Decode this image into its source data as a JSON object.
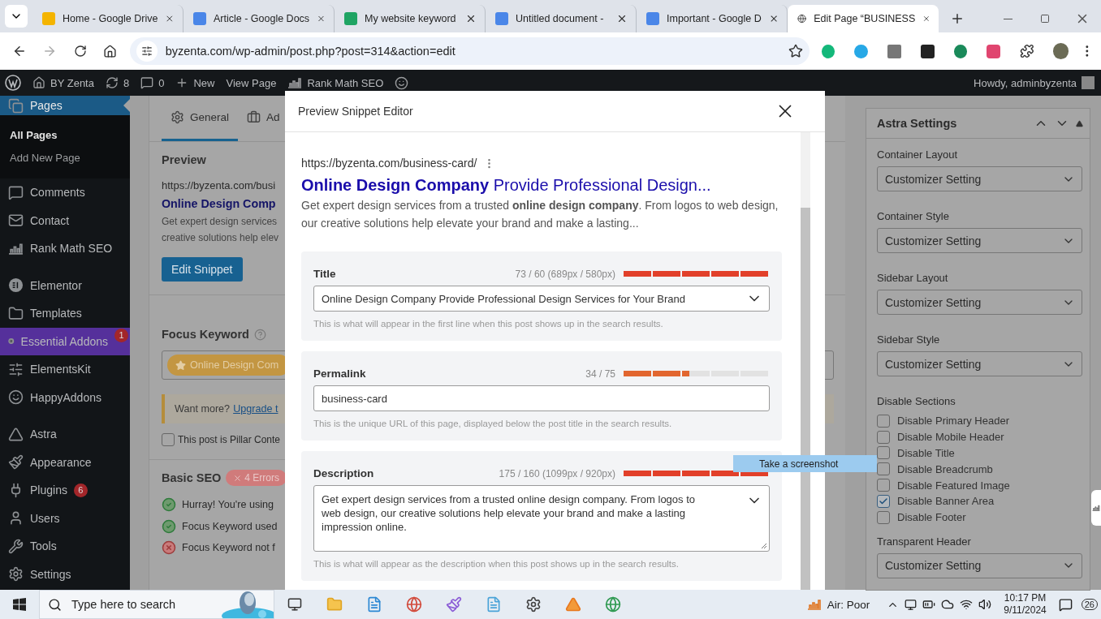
{
  "browser": {
    "tabs": [
      {
        "title": "Home - Google Drive",
        "selected": false
      },
      {
        "title": "Article - Google Docs",
        "selected": false
      },
      {
        "title": "My website keyword",
        "selected": false
      },
      {
        "title": "Untitled document -",
        "selected": false
      },
      {
        "title": "Important - Google D",
        "selected": false
      },
      {
        "title": "Edit Page “BUSINESS",
        "selected": true
      }
    ],
    "url": "byzenta.com/wp-admin/post.php?post=314&action=edit"
  },
  "admin_bar": {
    "items": [
      "BY Zenta",
      "8",
      "0",
      "New",
      "View Page",
      "Rank Math SEO"
    ],
    "greeting": "Howdy, adminbyzenta"
  },
  "sidebar": {
    "groups": [
      {
        "items": [
          {
            "label": "Pages",
            "selected": true,
            "highlighted": false,
            "children": [
              {
                "label": "All Pages",
                "selected": true
              },
              {
                "label": "Add New Page",
                "selected": false
              }
            ]
          },
          {
            "label": "Comments",
            "selected": false,
            "highlighted": false
          },
          {
            "label": "Contact",
            "selected": false,
            "highlighted": false
          },
          {
            "label": "Rank Math SEO",
            "selected": false,
            "highlighted": false
          }
        ]
      },
      {
        "items": [
          {
            "label": "Elementor",
            "selected": false,
            "highlighted": false
          },
          {
            "label": "Templates",
            "selected": false,
            "highlighted": false
          },
          {
            "label": "Essential Addons",
            "selected": false,
            "highlighted": true,
            "badge": "1"
          },
          {
            "label": "ElementsKit",
            "selected": false,
            "highlighted": false
          },
          {
            "label": "HappyAddons",
            "selected": false,
            "highlighted": false
          }
        ]
      },
      {
        "items": [
          {
            "label": "Astra",
            "selected": false,
            "highlighted": false
          },
          {
            "label": "Appearance",
            "selected": false,
            "highlighted": false
          },
          {
            "label": "Plugins",
            "selected": false,
            "highlighted": false,
            "badge": "6"
          },
          {
            "label": "Users",
            "selected": false,
            "highlighted": false
          },
          {
            "label": "Tools",
            "selected": false,
            "highlighted": false
          },
          {
            "label": "Settings",
            "selected": false,
            "highlighted": false
          }
        ]
      }
    ]
  },
  "rank_math": {
    "tabs": [
      {
        "label": "General",
        "selected": true
      },
      {
        "label": "Ad",
        "selected": false
      }
    ],
    "preview": {
      "heading": "Preview",
      "url": "https://byzenta.com/busi",
      "title": "Online Design Comp",
      "description_lines": [
        "Get expert design services",
        "creative solutions help elev"
      ],
      "button": "Edit Snippet"
    },
    "focus_keyword": {
      "label": "Focus Keyword",
      "keyword": "Online Design Com"
    },
    "notice": {
      "text": "Want more?",
      "link": "Upgrade t"
    },
    "pillar": {
      "label": "This post is Pillar Conte",
      "checked": false
    },
    "basic_seo": {
      "heading": "Basic SEO",
      "badge": "4 Errors",
      "checks": [
        {
          "text": "Hurray! You're using",
          "passed": true
        },
        {
          "text": "Focus Keyword used",
          "passed": true
        },
        {
          "text": "Focus Keyword not f",
          "passed": false
        }
      ]
    }
  },
  "modal": {
    "title": "Preview Snippet Editor",
    "snippet": {
      "url": "https://byzenta.com/business-card/",
      "title": "**Online Design Company** Provide Professional Design...",
      "description": "Get expert design services from a trusted **online design company**. From logos to web design, our creative solutions help elevate your brand and make a lasting..."
    },
    "fields": [
      {
        "kind": "select",
        "label": "Title",
        "counter": "73 / 60 (689px / 580px)",
        "level": 1,
        "color": "#e2402a",
        "value": "Online Design Company Provide Professional Design Services for Your Brand",
        "help": "This is what will appear in the first line when this post shows up in the search results."
      },
      {
        "kind": "input",
        "label": "Permalink",
        "counter": "34 / 75",
        "level": 0.45,
        "color": "#e2662f",
        "value": "business-card",
        "help": "This is the unique URL of this page, displayed below the post title in the search results."
      },
      {
        "kind": "textarea",
        "label": "Description",
        "counter": "175 / 160 (1099px / 920px)",
        "level": 1,
        "color": "#e2402a",
        "value": "Get expert design services from a trusted online design company. From logos to web design, our creative solutions help elevate your brand and make a lasting impression online.",
        "help": "This is what will appear as the description when this post shows up in the search results."
      }
    ]
  },
  "tooltip": "Take a screenshot",
  "astra": {
    "title": "Astra Settings",
    "sections": [
      {
        "kind": "select",
        "label": "Container Layout",
        "value": "Customizer Setting"
      },
      {
        "kind": "select",
        "label": "Container Style",
        "value": "Customizer Setting"
      },
      {
        "kind": "select",
        "label": "Sidebar Layout",
        "value": "Customizer Setting"
      },
      {
        "kind": "select",
        "label": "Sidebar Style",
        "value": "Customizer Setting"
      },
      {
        "kind": "checkboxes",
        "label": "Disable Sections",
        "options": [
          {
            "label": "Disable Primary Header",
            "checked": false
          },
          {
            "label": "Disable Mobile Header",
            "checked": false
          },
          {
            "label": "Disable Title",
            "checked": false
          },
          {
            "label": "Disable Breadcrumb",
            "checked": false
          },
          {
            "label": "Disable Featured Image",
            "checked": false
          },
          {
            "label": "Disable Banner Area",
            "checked": true
          },
          {
            "label": "Disable Footer",
            "checked": false
          }
        ]
      },
      {
        "kind": "select",
        "label": "Transparent Header",
        "value": "Customizer Setting"
      }
    ]
  },
  "taskbar": {
    "search_placeholder": "Type here to search",
    "air": "Air: Poor",
    "time": "10:17 PM",
    "date": "9/11/2024",
    "notifications": "26"
  }
}
